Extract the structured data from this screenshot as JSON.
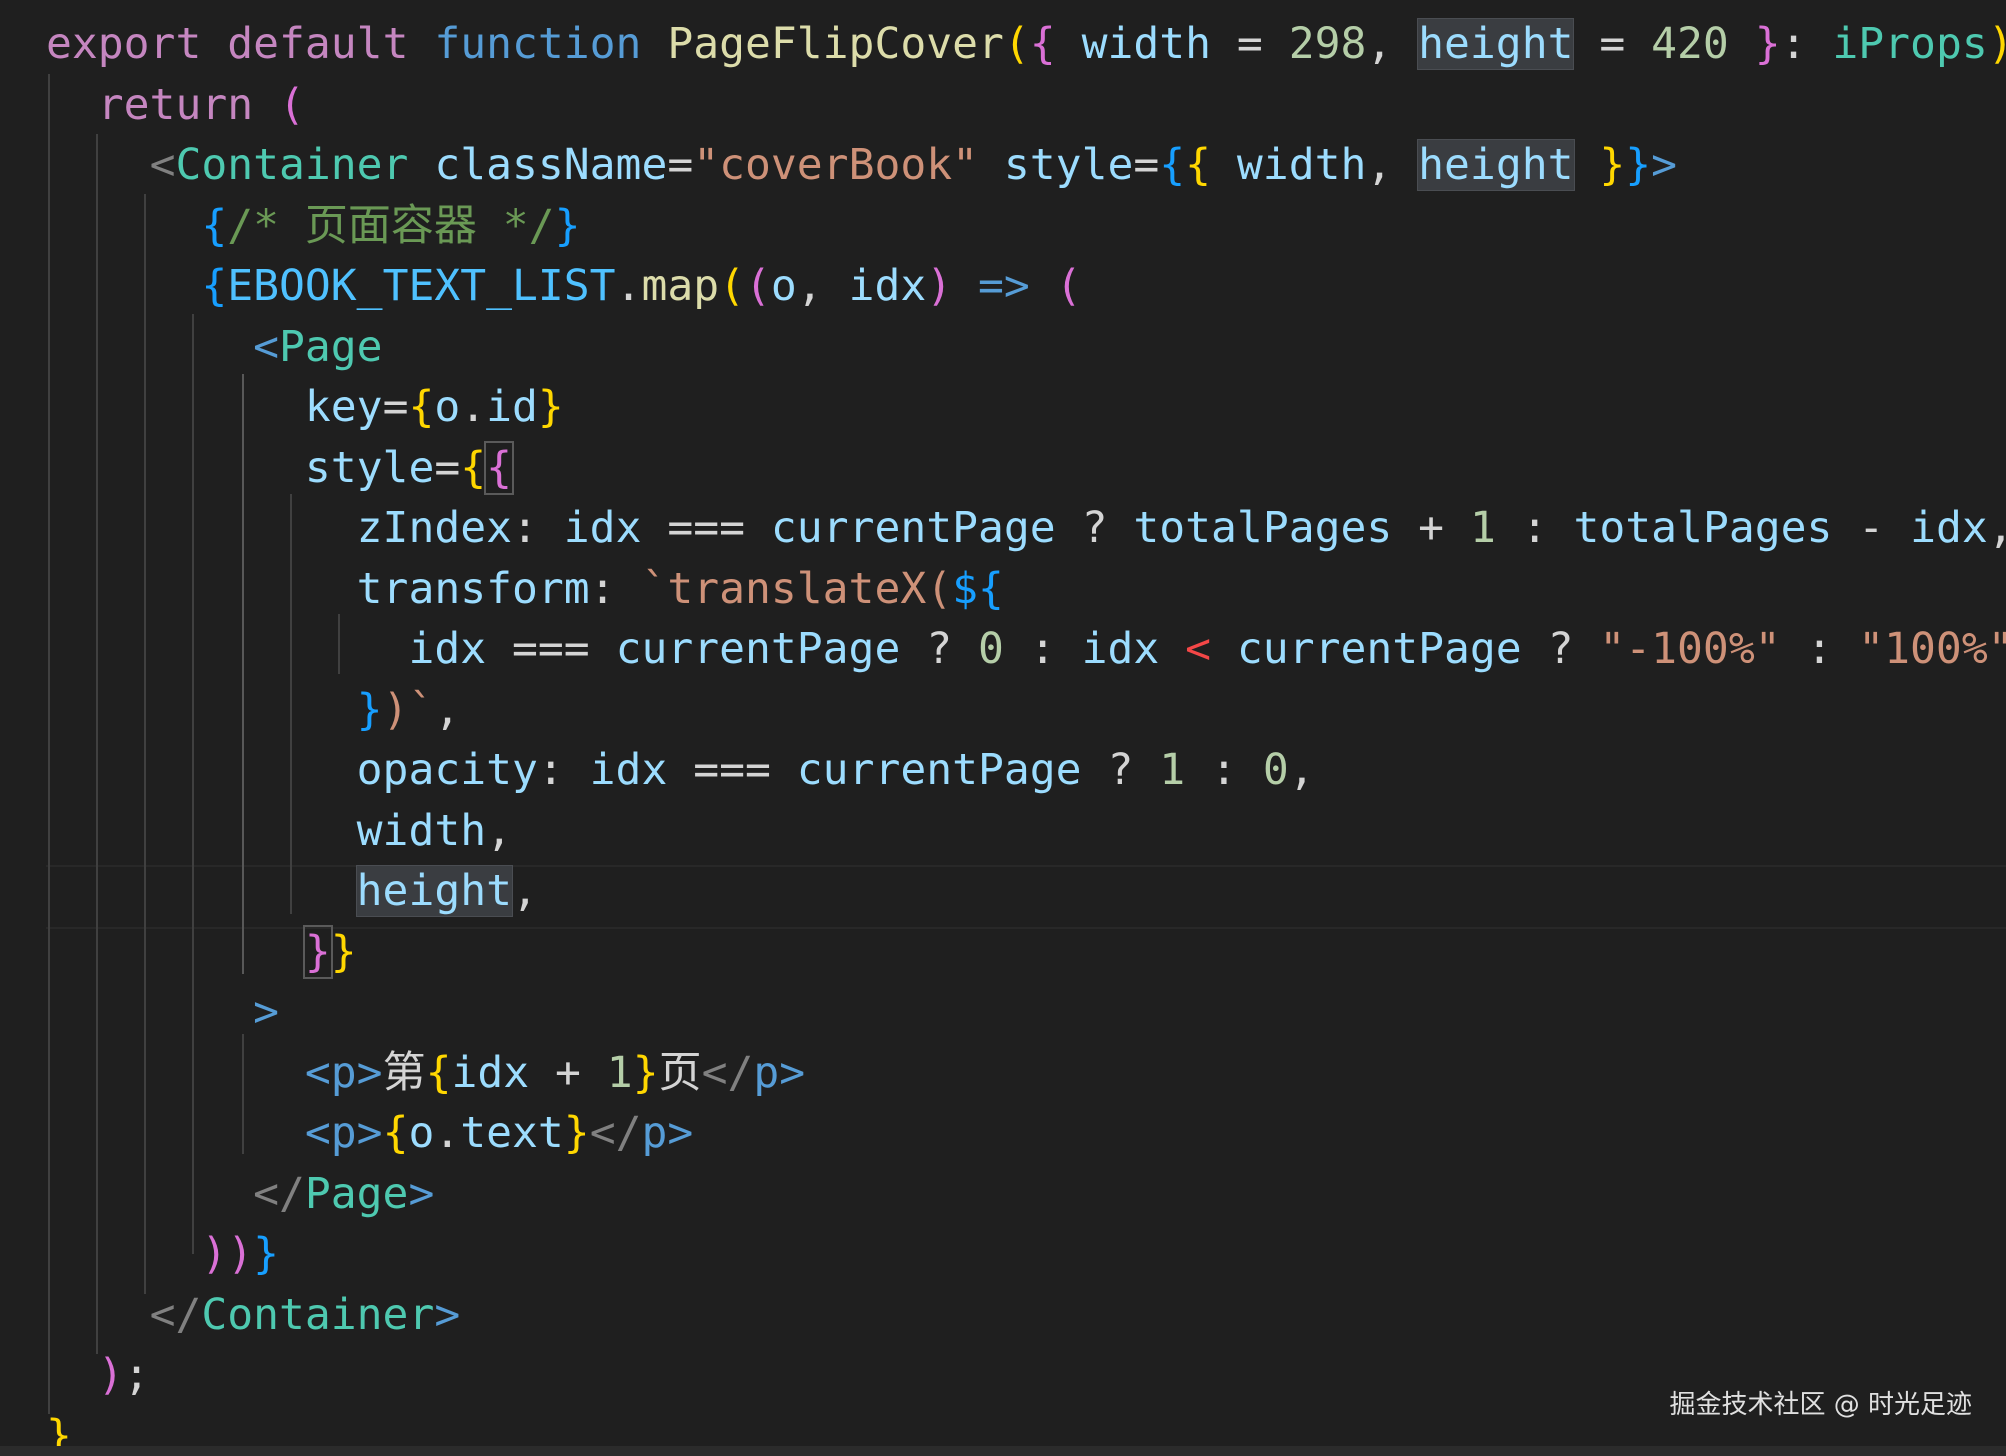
{
  "editor": {
    "language": "tsx",
    "theme_colors": {
      "background": "#1f1f1f",
      "keyword_control": "#c586c0",
      "keyword_storage": "#569cd6",
      "function": "#dcdcaa",
      "variable": "#9cdcfe",
      "number": "#b5cea8",
      "string": "#ce9178",
      "component": "#4ec9b0",
      "comment": "#6a9955",
      "constant": "#4fc1ff"
    },
    "highlighted_word": "height",
    "cursor_line": 15,
    "lines": [
      {
        "tokens": [
          [
            "kw-c",
            "export"
          ],
          [
            "punc",
            " "
          ],
          [
            "kw-c",
            "default"
          ],
          [
            "punc",
            " "
          ],
          [
            "kw-s",
            "function"
          ],
          [
            "punc",
            " "
          ],
          [
            "fn",
            "PageFlipCover"
          ],
          [
            "b1",
            "("
          ],
          [
            "b2",
            "{"
          ],
          [
            "punc",
            " "
          ],
          [
            "var",
            "width"
          ],
          [
            "punc",
            " = "
          ],
          [
            "num",
            "298"
          ],
          [
            "punc",
            ", "
          ],
          [
            "var hl",
            "height"
          ],
          [
            "punc",
            " = "
          ],
          [
            "num",
            "420"
          ],
          [
            "punc",
            " "
          ],
          [
            "b2",
            "}"
          ],
          [
            "punc",
            ": "
          ],
          [
            "type",
            "iProps"
          ],
          [
            "b1",
            ")"
          ],
          [
            "punc",
            " "
          ],
          [
            "b1",
            "{"
          ]
        ]
      },
      {
        "tokens": [
          [
            "punc",
            "  "
          ],
          [
            "kw-c",
            "return"
          ],
          [
            "punc",
            " "
          ],
          [
            "b2",
            "("
          ]
        ]
      },
      {
        "tokens": [
          [
            "punc",
            "    "
          ],
          [
            "tag",
            "<"
          ],
          [
            "comp",
            "Container"
          ],
          [
            "punc",
            " "
          ],
          [
            "attr",
            "className"
          ],
          [
            "punc",
            "="
          ],
          [
            "str",
            "\"coverBook\""
          ],
          [
            "punc",
            " "
          ],
          [
            "attr",
            "style"
          ],
          [
            "punc",
            "="
          ],
          [
            "b3",
            "{"
          ],
          [
            "b1",
            "{"
          ],
          [
            "punc",
            " "
          ],
          [
            "var",
            "width"
          ],
          [
            "punc",
            ", "
          ],
          [
            "var hl",
            "height"
          ],
          [
            "punc",
            " "
          ],
          [
            "b1",
            "}"
          ],
          [
            "b3",
            "}"
          ],
          [
            "tagb",
            ">"
          ]
        ]
      },
      {
        "tokens": [
          [
            "punc",
            "      "
          ],
          [
            "b3",
            "{"
          ],
          [
            "cmt",
            "/* 页面容器 */"
          ],
          [
            "b3",
            "}"
          ]
        ]
      },
      {
        "tokens": [
          [
            "punc",
            "      "
          ],
          [
            "b3",
            "{"
          ],
          [
            "cst",
            "EBOOK_TEXT_LIST"
          ],
          [
            "punc",
            "."
          ],
          [
            "fn",
            "map"
          ],
          [
            "b1",
            "("
          ],
          [
            "b2",
            "("
          ],
          [
            "var",
            "o"
          ],
          [
            "punc",
            ", "
          ],
          [
            "var",
            "idx"
          ],
          [
            "b2",
            ")"
          ],
          [
            "punc",
            " "
          ],
          [
            "arrow",
            "=>"
          ],
          [
            "punc",
            " "
          ],
          [
            "b2",
            "("
          ]
        ]
      },
      {
        "tokens": [
          [
            "punc",
            "        "
          ],
          [
            "tagb",
            "<"
          ],
          [
            "comp",
            "Page"
          ]
        ]
      },
      {
        "tokens": [
          [
            "punc",
            "          "
          ],
          [
            "attr",
            "key"
          ],
          [
            "punc",
            "="
          ],
          [
            "b1",
            "{"
          ],
          [
            "var",
            "o"
          ],
          [
            "punc",
            "."
          ],
          [
            "var",
            "id"
          ],
          [
            "b1",
            "}"
          ]
        ]
      },
      {
        "tokens": [
          [
            "punc",
            "          "
          ],
          [
            "attr",
            "style"
          ],
          [
            "punc",
            "="
          ],
          [
            "b1",
            "{"
          ],
          [
            "b2 bracket-box",
            "{"
          ]
        ]
      },
      {
        "tokens": [
          [
            "punc",
            "            "
          ],
          [
            "var",
            "zIndex"
          ],
          [
            "punc",
            ": "
          ],
          [
            "var",
            "idx"
          ],
          [
            "punc",
            " === "
          ],
          [
            "var",
            "currentPage"
          ],
          [
            "punc",
            " ? "
          ],
          [
            "var",
            "totalPages"
          ],
          [
            "punc",
            " + "
          ],
          [
            "num",
            "1"
          ],
          [
            "punc",
            " : "
          ],
          [
            "var",
            "totalPages"
          ],
          [
            "punc",
            " - "
          ],
          [
            "var",
            "idx"
          ],
          [
            "punc",
            ","
          ]
        ]
      },
      {
        "tokens": [
          [
            "punc",
            "            "
          ],
          [
            "var",
            "transform"
          ],
          [
            "punc",
            ": "
          ],
          [
            "str",
            "`translateX("
          ],
          [
            "b3",
            "${"
          ]
        ]
      },
      {
        "tokens": [
          [
            "punc",
            "              "
          ],
          [
            "var",
            "idx"
          ],
          [
            "punc",
            " === "
          ],
          [
            "var",
            "currentPage"
          ],
          [
            "punc",
            " ? "
          ],
          [
            "num",
            "0"
          ],
          [
            "punc",
            " : "
          ],
          [
            "var",
            "idx"
          ],
          [
            "punc",
            " "
          ],
          [
            "lt",
            "<"
          ],
          [
            "punc",
            " "
          ],
          [
            "var",
            "currentPage"
          ],
          [
            "punc",
            " ? "
          ],
          [
            "str",
            "\"-100%\""
          ],
          [
            "punc",
            " : "
          ],
          [
            "str",
            "\"100%\""
          ]
        ]
      },
      {
        "tokens": [
          [
            "punc",
            "            "
          ],
          [
            "b3",
            "}"
          ],
          [
            "str",
            ")`"
          ],
          [
            "punc",
            ","
          ]
        ]
      },
      {
        "tokens": [
          [
            "punc",
            "            "
          ],
          [
            "var",
            "opacity"
          ],
          [
            "punc",
            ": "
          ],
          [
            "var",
            "idx"
          ],
          [
            "punc",
            " === "
          ],
          [
            "var",
            "currentPage"
          ],
          [
            "punc",
            " ? "
          ],
          [
            "num",
            "1"
          ],
          [
            "punc",
            " : "
          ],
          [
            "num",
            "0"
          ],
          [
            "punc",
            ","
          ]
        ]
      },
      {
        "tokens": [
          [
            "punc",
            "            "
          ],
          [
            "var",
            "width"
          ],
          [
            "punc",
            ","
          ]
        ]
      },
      {
        "tokens": [
          [
            "punc",
            "            "
          ],
          [
            "var hl",
            "height"
          ],
          [
            "punc",
            ","
          ]
        ]
      },
      {
        "tokens": [
          [
            "punc",
            "          "
          ],
          [
            "b2 bracket-box",
            "}"
          ],
          [
            "b1",
            "}"
          ]
        ]
      },
      {
        "tokens": [
          [
            "punc",
            "        "
          ],
          [
            "tagb",
            ">"
          ]
        ]
      },
      {
        "tokens": [
          [
            "punc",
            "          "
          ],
          [
            "tagb",
            "<"
          ],
          [
            "tagb",
            "p"
          ],
          [
            "tagb",
            ">"
          ],
          [
            "text",
            "第"
          ],
          [
            "b1",
            "{"
          ],
          [
            "var",
            "idx"
          ],
          [
            "punc",
            " + "
          ],
          [
            "num",
            "1"
          ],
          [
            "b1",
            "}"
          ],
          [
            "text",
            "页"
          ],
          [
            "tag",
            "</"
          ],
          [
            "tagb",
            "p"
          ],
          [
            "tagb",
            ">"
          ]
        ]
      },
      {
        "tokens": [
          [
            "punc",
            "          "
          ],
          [
            "tagb",
            "<"
          ],
          [
            "tagb",
            "p"
          ],
          [
            "tagb",
            ">"
          ],
          [
            "b1",
            "{"
          ],
          [
            "var",
            "o"
          ],
          [
            "punc",
            "."
          ],
          [
            "var",
            "text"
          ],
          [
            "b1",
            "}"
          ],
          [
            "tag",
            "</"
          ],
          [
            "tagb",
            "p"
          ],
          [
            "tagb",
            ">"
          ]
        ]
      },
      {
        "tokens": [
          [
            "punc",
            "        "
          ],
          [
            "tag",
            "</"
          ],
          [
            "comp",
            "Page"
          ],
          [
            "tagb",
            ">"
          ]
        ]
      },
      {
        "tokens": [
          [
            "punc",
            "      "
          ],
          [
            "b2",
            "))"
          ],
          [
            "b3",
            "}"
          ]
        ]
      },
      {
        "tokens": [
          [
            "punc",
            "    "
          ],
          [
            "tag",
            "</"
          ],
          [
            "comp",
            "Container"
          ],
          [
            "tagb",
            ">"
          ]
        ]
      },
      {
        "tokens": [
          [
            "punc",
            "  "
          ],
          [
            "b2",
            ")"
          ],
          [
            "punc",
            ";"
          ]
        ]
      },
      {
        "tokens": [
          [
            "b1",
            "}"
          ]
        ]
      }
    ]
  },
  "watermark": "掘金技术社区 @ 时光足迹"
}
